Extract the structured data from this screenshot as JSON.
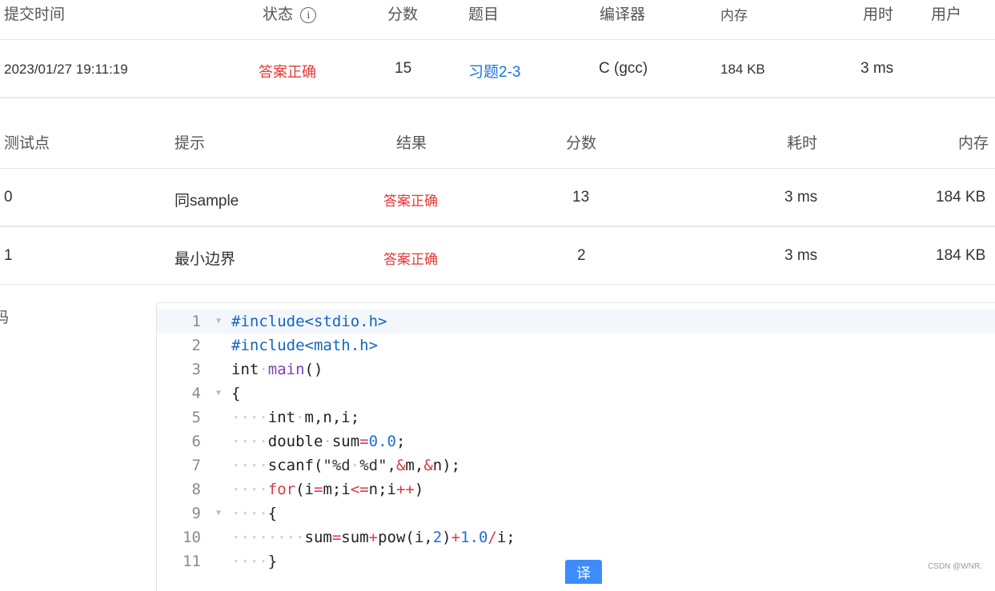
{
  "submission_table": {
    "headers": {
      "time": "提交时间",
      "status": "状态",
      "score": "分数",
      "problem": "题目",
      "compiler": "编译器",
      "memory": "内存",
      "duration": "用时",
      "user": "用户"
    },
    "row": {
      "time": "2023/01/27 19:11:19",
      "status": "答案正确",
      "score": "15",
      "problem": "习题2-3",
      "compiler": "C (gcc)",
      "memory": "184 KB",
      "duration": "3 ms",
      "user": ""
    }
  },
  "test_table": {
    "headers": {
      "case": "测试点",
      "hint": "提示",
      "result": "结果",
      "score": "分数",
      "time": "耗时",
      "memory": "内存"
    },
    "rows": [
      {
        "case": "0",
        "hint": "同sample",
        "result": "答案正确",
        "score": "13",
        "time": "3 ms",
        "memory": "184 KB"
      },
      {
        "case": "1",
        "hint": "最小边界",
        "result": "答案正确",
        "score": "2",
        "time": "3 ms",
        "memory": "184 KB"
      }
    ]
  },
  "code_section": {
    "label": "码",
    "line_numbers": [
      "1",
      "2",
      "3",
      "4",
      "5",
      "6",
      "7",
      "8",
      "9",
      "10",
      "11"
    ],
    "lines_plain": [
      "#include<stdio.h>",
      "#include<math.h>",
      "int main()",
      "{",
      "    int m,n,i;",
      "    double sum=0.0;",
      "    scanf(\"%d %d\",&m,&n);",
      "    for(i=m;i<=n;i++)",
      "    {",
      "        sum=sum+pow(i,2)+1.0/i;",
      "    }"
    ]
  },
  "floating_button": {
    "label": "译"
  },
  "watermark": "CSDN @WNR."
}
